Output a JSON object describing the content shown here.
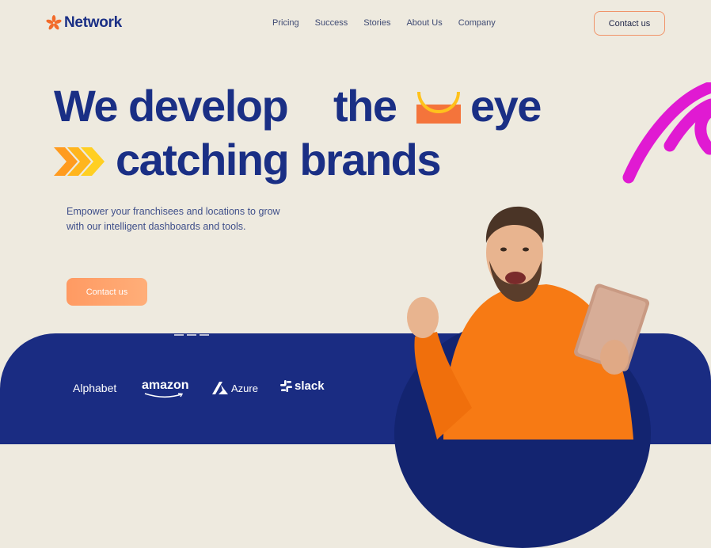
{
  "brand": {
    "name": "Network"
  },
  "nav": {
    "items": [
      {
        "label": "Pricing"
      },
      {
        "label": "Success"
      },
      {
        "label": "Stories"
      },
      {
        "label": "About Us"
      },
      {
        "label": "Company"
      }
    ],
    "contact_label": "Contact us"
  },
  "hero": {
    "line1_word1": "We develop",
    "line1_word2": "the",
    "line1_word3": "eye",
    "line2": "catching brands",
    "subtext": "Empower your franchisees and locations to grow with our intelligent dashboards and tools.",
    "cta_label": "Contact us"
  },
  "partners": [
    {
      "name": "Alphabet"
    },
    {
      "name": "amazon"
    },
    {
      "name": "Azure"
    },
    {
      "name": "slack"
    }
  ],
  "colors": {
    "background": "#eeeadf",
    "primary": "#1a2f85",
    "accent_orange": "#ff9a62",
    "accent_yellow": "#ffc21c",
    "accent_magenta": "#e01ad2",
    "band": "#1a2c82"
  },
  "icons": [
    "network-logo-icon",
    "half-bowl-icon",
    "chevrons-icon",
    "swirl-icon",
    "azure-icon",
    "slack-icon",
    "amazon-smile-icon"
  ]
}
